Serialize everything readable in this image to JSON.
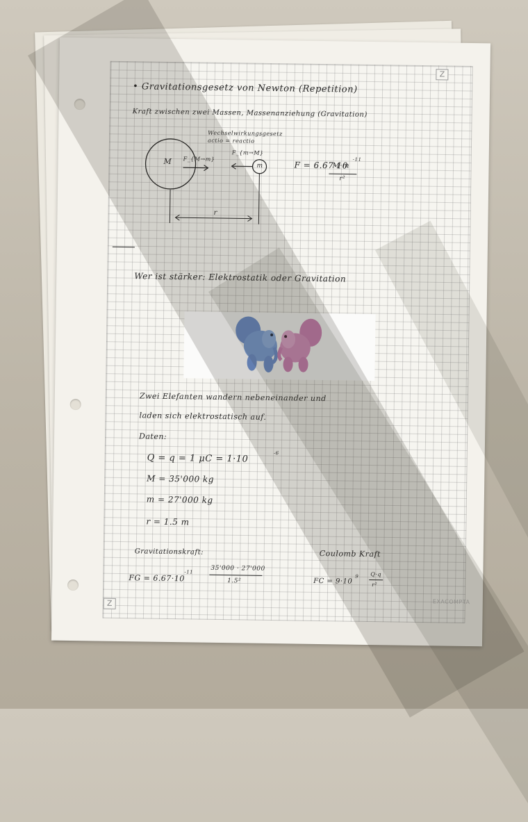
{
  "page": {
    "heading": "• Gravitationsgesetz von Newton (Repetition)",
    "subheading": "Kraft zwischen zwei Massen, Massenanziehung (Gravitation)",
    "diagram": {
      "label_top1": "Wechselwirkungsgesetz",
      "label_top2": "actio = reactio",
      "mass_big": "M",
      "force_big": "F_{M→m}",
      "force_small": "F_{m→M}",
      "mass_small": "m",
      "distance": "r",
      "formula_lhs": "F = 6.67·10",
      "formula_exp": "-11",
      "formula_num": "M·m",
      "formula_den": "r²"
    },
    "question": "Wer ist stärker: Elektrostatik oder Gravitation",
    "problem_line1": "Zwei Elefanten wandern nebeneinander und",
    "problem_line2": "laden sich elektrostatisch auf.",
    "data_label": "Daten:",
    "data": [
      "Q = q = 1 μC = 1·10",
      "M = 35'000 kg",
      "m = 27'000 kg",
      "r = 1.5 m"
    ],
    "charge_exp": "-6",
    "gravity_title": "Gravitationskraft:",
    "gravity_lhs": "FG = 6.67·10",
    "gravity_exp": "-11",
    "gravity_num": "35'000 · 27'000",
    "gravity_den": "1.5²",
    "coulomb_title": "Coulomb Kraft",
    "coulomb_lhs": "FC = 9·10",
    "coulomb_exp": "9",
    "coulomb_num": "Q·q",
    "coulomb_den": "r²",
    "corner_icon": "Z",
    "brand": "EXACOMPTA"
  }
}
